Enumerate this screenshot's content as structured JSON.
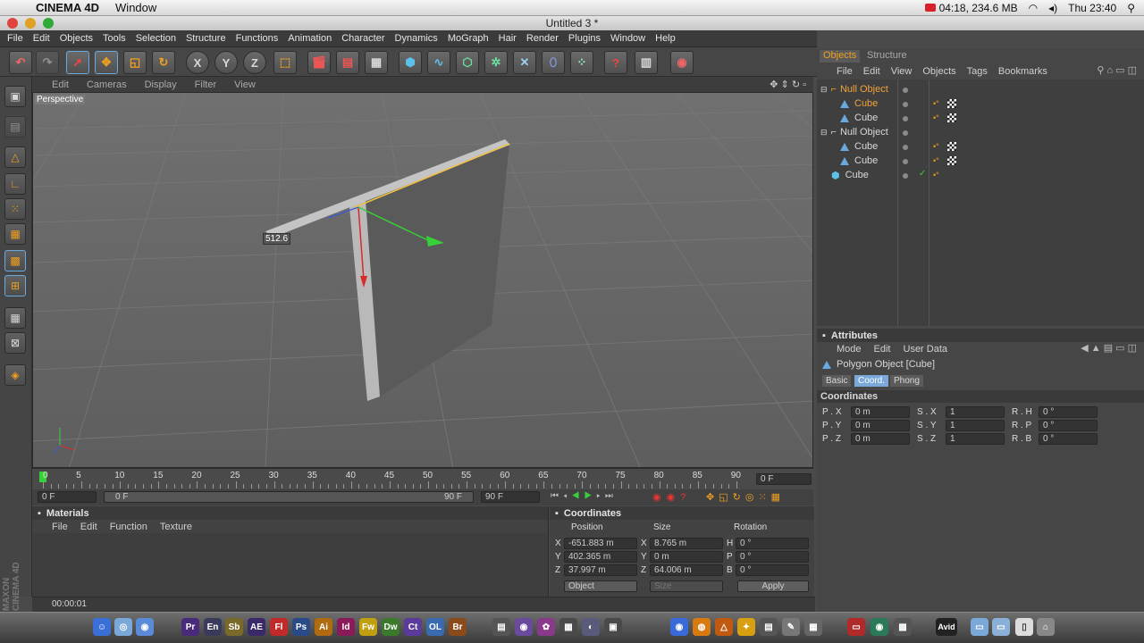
{
  "menubar": {
    "app": "CINEMA 4D",
    "window": "Window",
    "recording": "04:18, 234.6 MB",
    "clock": "Thu 23:40"
  },
  "window_title": "Untitled 3 *",
  "app_menu": [
    "File",
    "Edit",
    "Objects",
    "Tools",
    "Selection",
    "Structure",
    "Functions",
    "Animation",
    "Character",
    "Dynamics",
    "MoGraph",
    "Hair",
    "Render",
    "Plugins",
    "Window",
    "Help"
  ],
  "toolbar": {
    "x": "X",
    "y": "Y",
    "z": "Z"
  },
  "viewport": {
    "menu": [
      "Edit",
      "Cameras",
      "Display",
      "Filter",
      "View"
    ],
    "label": "Perspective",
    "measure": "512.6"
  },
  "timeline": {
    "ticks": [
      "0",
      "5",
      "10",
      "15",
      "20",
      "25",
      "30",
      "35",
      "40",
      "45",
      "50",
      "55",
      "60",
      "65",
      "70",
      "75",
      "80",
      "85",
      "90"
    ],
    "current_frame": "0 F",
    "start": "0 F",
    "range_start": "0 F",
    "range_end": "90 F",
    "end": "90 F"
  },
  "materials": {
    "title": "Materials",
    "menu": [
      "File",
      "Edit",
      "Function",
      "Texture"
    ]
  },
  "coordinates": {
    "title": "Coordinates",
    "headers": [
      "Position",
      "Size",
      "Rotation"
    ],
    "rows": [
      {
        "axis": "X",
        "pos": "-651.883 m",
        "saxis": "X",
        "size": "8.765 m",
        "raxis": "H",
        "rot": "0 °"
      },
      {
        "axis": "Y",
        "pos": "402.365 m",
        "saxis": "Y",
        "size": "0 m",
        "raxis": "P",
        "rot": "0 °"
      },
      {
        "axis": "Z",
        "pos": "37.997 m",
        "saxis": "Z",
        "size": "64.006 m",
        "raxis": "B",
        "rot": "0 °"
      }
    ],
    "mode": "Object",
    "size_mode": "Size",
    "apply": "Apply"
  },
  "status": "00:00:01",
  "objects": {
    "tabs": [
      "Objects",
      "Structure"
    ],
    "menu": [
      "File",
      "Edit",
      "View",
      "Objects",
      "Tags",
      "Bookmarks"
    ],
    "tree": [
      {
        "name": "Null Object",
        "level": 0,
        "type": "null",
        "selected": true
      },
      {
        "name": "Cube",
        "level": 1,
        "type": "poly",
        "selected": true
      },
      {
        "name": "Cube",
        "level": 1,
        "type": "poly",
        "selected": false
      },
      {
        "name": "Null Object",
        "level": 0,
        "type": "null",
        "selected": false
      },
      {
        "name": "Cube",
        "level": 1,
        "type": "poly",
        "selected": false
      },
      {
        "name": "Cube",
        "level": 1,
        "type": "poly",
        "selected": false
      },
      {
        "name": "Cube",
        "level": 0,
        "type": "cube",
        "selected": false
      }
    ]
  },
  "attributes": {
    "title": "Attributes",
    "menu": [
      "Mode",
      "Edit",
      "User Data"
    ],
    "object_title": "Polygon Object [Cube]",
    "tabs": [
      "Basic",
      "Coord.",
      "Phong"
    ],
    "section": "Coordinates",
    "rows": [
      [
        {
          "label": "P . X",
          "value": "0 m"
        },
        {
          "label": "S . X",
          "value": "1"
        },
        {
          "label": "R . H",
          "value": "0 °"
        }
      ],
      [
        {
          "label": "P . Y",
          "value": "0 m"
        },
        {
          "label": "S . Y",
          "value": "1"
        },
        {
          "label": "R . P",
          "value": "0 °"
        }
      ],
      [
        {
          "label": "P . Z",
          "value": "0 m"
        },
        {
          "label": "S . Z",
          "value": "1"
        },
        {
          "label": "R . B",
          "value": "0 °"
        }
      ]
    ]
  },
  "side_brand": "MAXON CINEMA 4D",
  "dock": [
    "Pr",
    "En",
    "Sb",
    "AE",
    "Fl",
    "Ps",
    "Ai",
    "Id",
    "Fw",
    "Dw",
    "Ct",
    "OL",
    "Br",
    "Avid"
  ],
  "colors": {
    "accent": "#f0a020",
    "selected_text": "#f2a23a",
    "axis_x": "#d82a2a",
    "axis_y": "#38d038",
    "axis_z": "#3a5ad8"
  }
}
